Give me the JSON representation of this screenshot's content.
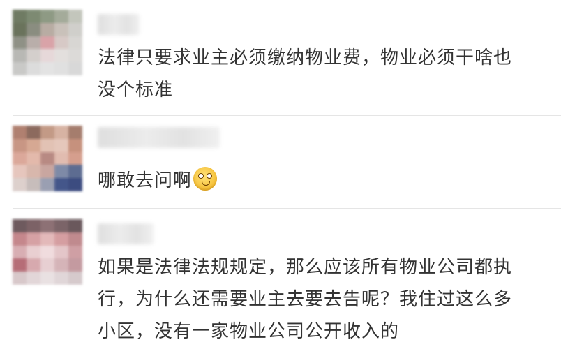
{
  "comments": [
    {
      "text_lines": [
        "法律只要求业主必须缴纳物业费，物业必须干啥也",
        "没个标准"
      ]
    },
    {
      "text_lines": [
        "哪敢去问啊"
      ],
      "emoji": "grimace-emoji"
    },
    {
      "text_lines": [
        "如果是法律法规规定，那么应该所有物业公司都执",
        "行，为什么还需要业主去要去告呢？我住过这么多",
        "小区，没有一家物业公司公开收入的"
      ]
    }
  ]
}
